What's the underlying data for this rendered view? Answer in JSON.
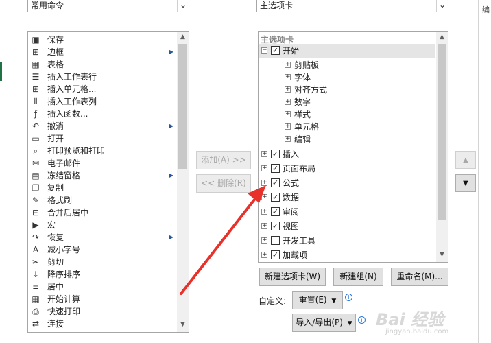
{
  "left_dropdown": {
    "value": "常用命令"
  },
  "right_dropdown": {
    "value": "主选项卡"
  },
  "commands": [
    {
      "label": "保存",
      "icon": "save-icon",
      "glyph": "▣",
      "submenu": false
    },
    {
      "label": "边框",
      "icon": "border-icon",
      "glyph": "⊞",
      "submenu": true
    },
    {
      "label": "表格",
      "icon": "table-icon",
      "glyph": "▦",
      "submenu": false
    },
    {
      "label": "插入工作表行",
      "icon": "insert-rows-icon",
      "glyph": "☰",
      "submenu": false
    },
    {
      "label": "插入单元格...",
      "icon": "insert-cells-icon",
      "glyph": "⊞",
      "submenu": false
    },
    {
      "label": "插入工作表列",
      "icon": "insert-columns-icon",
      "glyph": "⫴",
      "submenu": false
    },
    {
      "label": "插入函数...",
      "icon": "function-icon",
      "glyph": "ƒ",
      "submenu": false
    },
    {
      "label": "撤消",
      "icon": "undo-icon",
      "glyph": "↶",
      "submenu": true
    },
    {
      "label": "打开",
      "icon": "open-folder-icon",
      "glyph": "▭",
      "submenu": false
    },
    {
      "label": "打印预览和打印",
      "icon": "print-preview-icon",
      "glyph": "⌕",
      "submenu": false
    },
    {
      "label": "电子邮件",
      "icon": "email-attachment-icon",
      "glyph": "✉",
      "submenu": false
    },
    {
      "label": "冻结窗格",
      "icon": "freeze-panes-icon",
      "glyph": "▤",
      "submenu": true
    },
    {
      "label": "复制",
      "icon": "copy-icon",
      "glyph": "❐",
      "submenu": false
    },
    {
      "label": "格式刷",
      "icon": "format-painter-icon",
      "glyph": "✎",
      "submenu": false
    },
    {
      "label": "合并后居中",
      "icon": "merge-center-icon",
      "glyph": "⊟",
      "submenu": false
    },
    {
      "label": "宏",
      "icon": "macro-play-icon",
      "glyph": "▶",
      "submenu": false
    },
    {
      "label": "恢复",
      "icon": "redo-icon",
      "glyph": "↷",
      "submenu": true
    },
    {
      "label": "减小字号",
      "icon": "decrease-font-icon",
      "glyph": "A",
      "submenu": false
    },
    {
      "label": "剪切",
      "icon": "cut-icon",
      "glyph": "✂",
      "submenu": false
    },
    {
      "label": "降序排序",
      "icon": "sort-descending-icon",
      "glyph": "↓",
      "submenu": false
    },
    {
      "label": "居中",
      "icon": "align-center-icon",
      "glyph": "≡",
      "submenu": false
    },
    {
      "label": "开始计算",
      "icon": "calculator-icon",
      "glyph": "▦",
      "submenu": false
    },
    {
      "label": "快速打印",
      "icon": "quick-print-icon",
      "glyph": "⎙",
      "submenu": false
    },
    {
      "label": "连接",
      "icon": "connections-icon",
      "glyph": "⇄",
      "submenu": false
    }
  ],
  "tree": {
    "header": "主选项卡",
    "items": [
      {
        "label": "开始",
        "level": 0,
        "checked": true,
        "has_check": true,
        "expanded": true,
        "selected": true
      },
      {
        "label": "剪贴板",
        "level": 1,
        "has_check": false
      },
      {
        "label": "字体",
        "level": 1,
        "has_check": false
      },
      {
        "label": "对齐方式",
        "level": 1,
        "has_check": false
      },
      {
        "label": "数字",
        "level": 1,
        "has_check": false
      },
      {
        "label": "样式",
        "level": 1,
        "has_check": false
      },
      {
        "label": "单元格",
        "level": 1,
        "has_check": false
      },
      {
        "label": "编辑",
        "level": 1,
        "has_check": false
      },
      {
        "label": "插入",
        "level": 0,
        "checked": true,
        "has_check": true
      },
      {
        "label": "页面布局",
        "level": 0,
        "checked": true,
        "has_check": true
      },
      {
        "label": "公式",
        "level": 0,
        "checked": true,
        "has_check": true
      },
      {
        "label": "数据",
        "level": 0,
        "checked": true,
        "has_check": true
      },
      {
        "label": "审阅",
        "level": 0,
        "checked": true,
        "has_check": true
      },
      {
        "label": "视图",
        "level": 0,
        "checked": true,
        "has_check": true
      },
      {
        "label": "开发工具",
        "level": 0,
        "checked": false,
        "has_check": true
      },
      {
        "label": "加载项",
        "level": 0,
        "checked": true,
        "has_check": true
      }
    ]
  },
  "buttons": {
    "add": "添加(A) >>",
    "remove": "<< 删除(R)",
    "new_tab": "新建选项卡(W)",
    "new_group": "新建组(N)",
    "rename": "重命名(M)...",
    "reset": "重置(E)",
    "import_export": "导入/导出(P)"
  },
  "labels": {
    "customize": "自定义:",
    "right_edge": "编"
  },
  "watermark": {
    "brand": "Bai 经验",
    "url": "jingyan.baidu.com"
  },
  "colors": {
    "arrow": "#e8312a",
    "selected_row": "#e5e5e5",
    "green_edge": "#217346"
  }
}
